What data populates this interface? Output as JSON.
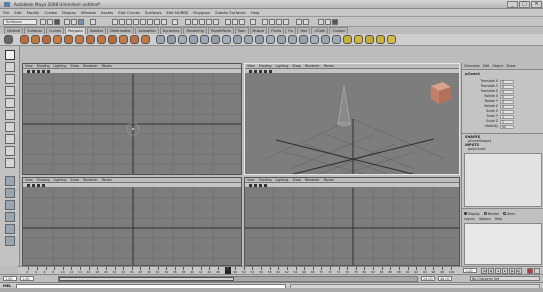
{
  "window": {
    "title": "Autodesk Maya 2008 Unlimited: untitled*",
    "buttons": [
      "_",
      "□",
      "×"
    ]
  },
  "menubar": [
    "File",
    "Edit",
    "Modify",
    "Create",
    "Display",
    "Window",
    "Assets",
    "Edit Curves",
    "Surfaces",
    "Edit NURBS",
    "Polygons",
    "Subdiv Surfaces",
    "Help"
  ],
  "statusline": {
    "mode": "Surfaces"
  },
  "shelf": {
    "tabs": [
      "General",
      "Surfaces",
      "Curves",
      "Polygons",
      "Subdivs",
      "Deformation",
      "Animation",
      "Dynamics",
      "Rendering",
      "PaintEffects",
      "Toon",
      "Muscle",
      "Fluids",
      "Fur",
      "Hair",
      "nCloth",
      "Custom"
    ],
    "active_tab": "Polygons"
  },
  "viewports": {
    "menu": [
      "View",
      "Shading",
      "Lighting",
      "Show",
      "Renderer",
      "Panels"
    ],
    "panels": [
      {
        "name": "top"
      },
      {
        "name": "persp"
      },
      {
        "name": "side"
      },
      {
        "name": "front"
      }
    ]
  },
  "channel_box": {
    "menu": [
      "Channels",
      "Edit",
      "Object",
      "Show"
    ],
    "object": "pCone1",
    "attributes": [
      {
        "name": "Translate X",
        "value": "0"
      },
      {
        "name": "Translate Y",
        "value": "0"
      },
      {
        "name": "Translate Z",
        "value": "0"
      },
      {
        "name": "Rotate X",
        "value": "0"
      },
      {
        "name": "Rotate Y",
        "value": "0"
      },
      {
        "name": "Rotate Z",
        "value": "0"
      },
      {
        "name": "Scale X",
        "value": "1"
      },
      {
        "name": "Scale Y",
        "value": "1"
      },
      {
        "name": "Scale Z",
        "value": "1"
      },
      {
        "name": "Visibility",
        "value": "on"
      }
    ],
    "shapes_label": "SHAPES",
    "shape_name": "pConeShape1",
    "inputs_label": "INPUTS",
    "input_name": "polyCone1"
  },
  "layer_editor": {
    "modes": [
      "Display",
      "Render",
      "Anim"
    ],
    "menu": [
      "Layers",
      "Options",
      "Help"
    ]
  },
  "timeline": {
    "ticks": [
      "2",
      "4",
      "6",
      "8",
      "10",
      "12",
      "14",
      "16",
      "18",
      "20",
      "22",
      "24",
      "26",
      "28",
      "30",
      "32",
      "34",
      "36",
      "38",
      "40",
      "42",
      "44",
      "46",
      "48",
      "50",
      "52",
      "54",
      "56",
      "58",
      "60",
      "62",
      "64",
      "66",
      "68",
      "70",
      "72",
      "74",
      "76",
      "78",
      "80",
      "82",
      "84",
      "86",
      "88",
      "90",
      "92",
      "94",
      "96",
      "98",
      "100"
    ],
    "current_frame": "1.00",
    "play_buttons": [
      "|◂",
      "◂|",
      "◂",
      "▸",
      "|▸",
      "▸|"
    ]
  },
  "range": {
    "start": "1.00",
    "range_start": "1.00",
    "range_end": "24.00",
    "end": "48.00",
    "character_set": "No Character Set"
  },
  "command_line": {
    "label": "MEL"
  }
}
